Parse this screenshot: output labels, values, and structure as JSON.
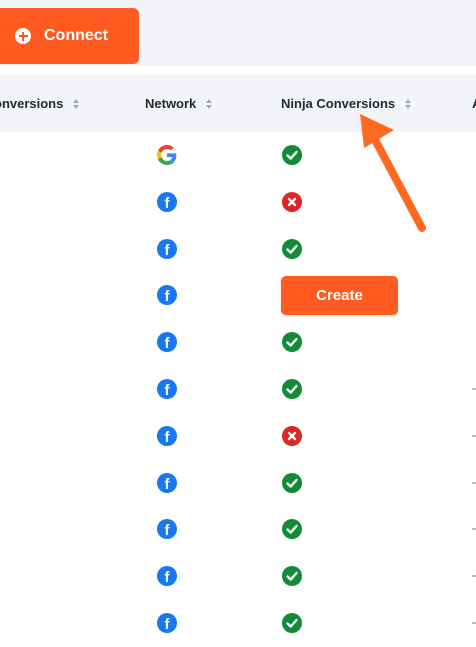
{
  "toolbar": {
    "connect_label": "Connect",
    "connect_icon": "plus-circle-icon"
  },
  "table": {
    "columns": [
      {
        "key": "conversions",
        "label": "onversions",
        "sortable": true
      },
      {
        "key": "network",
        "label": "Network",
        "sortable": true
      },
      {
        "key": "ninja_conversions",
        "label": "Ninja Conversions",
        "sortable": true
      },
      {
        "key": "next",
        "label": "A",
        "sortable": false
      }
    ],
    "rows": [
      {
        "network": "google",
        "ninja_status": "check"
      },
      {
        "network": "facebook",
        "ninja_status": "error"
      },
      {
        "network": "facebook",
        "ninja_status": "check"
      },
      {
        "network": "facebook",
        "ninja_status": "create",
        "action_label": "Create"
      },
      {
        "network": "facebook",
        "ninja_status": "check"
      },
      {
        "network": "facebook",
        "ninja_status": "check"
      },
      {
        "network": "facebook",
        "ninja_status": "error"
      },
      {
        "network": "facebook",
        "ninja_status": "check"
      },
      {
        "network": "facebook",
        "ninja_status": "check"
      },
      {
        "network": "facebook",
        "ninja_status": "check"
      },
      {
        "network": "facebook",
        "ninja_status": "check"
      }
    ]
  },
  "colors": {
    "accent": "#ff5a1f",
    "success": "#138a36",
    "error": "#e02424",
    "facebook": "#1877f2",
    "header_bg": "#f2f4f7"
  },
  "annotation": {
    "icon": "orange-arrow-icon"
  }
}
